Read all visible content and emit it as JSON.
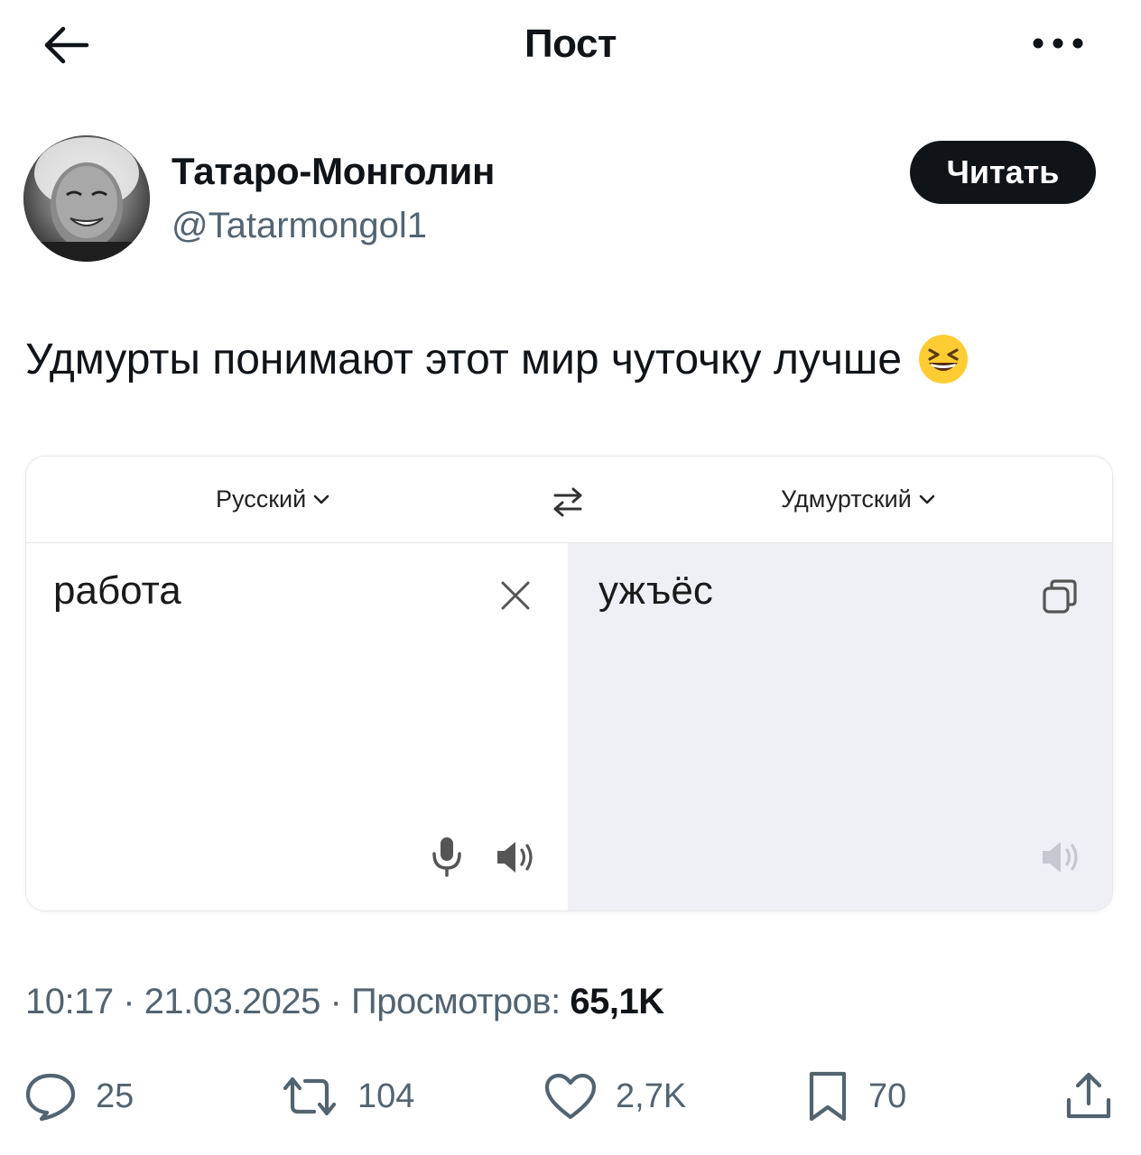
{
  "header": {
    "title": "Пост",
    "back_icon": "arrow-left-icon",
    "more_icon": "ellipsis-icon"
  },
  "author": {
    "name": "Татаро-Монголин",
    "handle": "@Tatarmongol1",
    "follow_label": "Читать"
  },
  "post": {
    "text": "Удмурты понимают этот мир чуточку лучше",
    "emoji": "grinning-squinting-face"
  },
  "translator": {
    "source_lang": "Русский",
    "target_lang": "Удмуртский",
    "source_text": "работа",
    "target_text": "ужъёс"
  },
  "meta": {
    "time": "10:17",
    "separator": "·",
    "date": "21.03.2025",
    "views_label": "Просмотров:",
    "views_count": "65,1K"
  },
  "actions": {
    "replies": "25",
    "reposts": "104",
    "likes": "2,7K",
    "bookmarks": "70"
  },
  "colors": {
    "text_primary": "#0f1419",
    "text_secondary": "#536471",
    "follow_bg": "#0f1419",
    "target_pane_bg": "#eef0f5"
  }
}
